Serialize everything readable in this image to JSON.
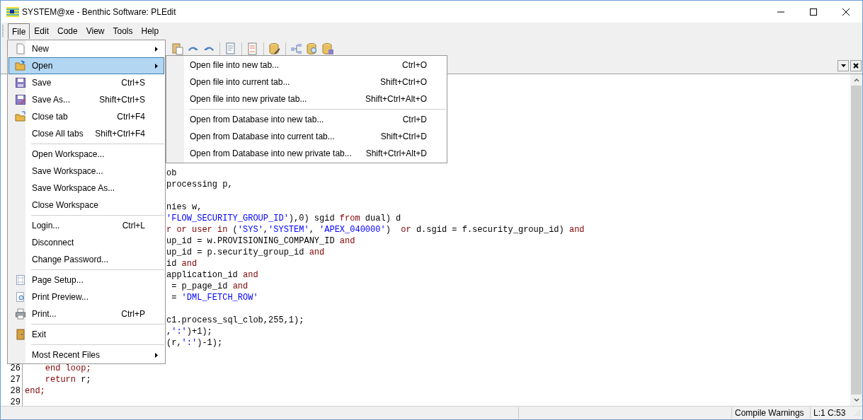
{
  "window": {
    "title": "SYSTEM@xe - Benthic Software: PLEdit"
  },
  "menubar": [
    {
      "label": "File",
      "selected": true
    },
    {
      "label": "Edit",
      "selected": false
    },
    {
      "label": "Code",
      "selected": false
    },
    {
      "label": "View",
      "selected": false
    },
    {
      "label": "Tools",
      "selected": false
    },
    {
      "label": "Help",
      "selected": false
    }
  ],
  "file_menu": [
    {
      "kind": "item",
      "label": "New",
      "submenu": true,
      "selected": false
    },
    {
      "kind": "item",
      "label": "Open",
      "submenu": true,
      "selected": true
    },
    {
      "kind": "item",
      "label": "Save",
      "shortcut": "Ctrl+S",
      "selected": false
    },
    {
      "kind": "item",
      "label": "Save As...",
      "shortcut": "Shift+Ctrl+S",
      "selected": false
    },
    {
      "kind": "item",
      "label": "Close tab",
      "shortcut": "Ctrl+F4",
      "selected": false
    },
    {
      "kind": "item",
      "label": "Close All tabs",
      "shortcut": "Shift+Ctrl+F4",
      "selected": false
    },
    {
      "kind": "separator"
    },
    {
      "kind": "item",
      "label": "Open Workspace...",
      "selected": false
    },
    {
      "kind": "item",
      "label": "Save Workspace...",
      "selected": false
    },
    {
      "kind": "item",
      "label": "Save Workspace As...",
      "selected": false
    },
    {
      "kind": "item",
      "label": "Close Workspace",
      "selected": false
    },
    {
      "kind": "separator"
    },
    {
      "kind": "item",
      "label": "Login...",
      "shortcut": "Ctrl+L",
      "selected": false
    },
    {
      "kind": "item",
      "label": "Disconnect",
      "selected": false
    },
    {
      "kind": "item",
      "label": "Change Password...",
      "selected": false
    },
    {
      "kind": "separator"
    },
    {
      "kind": "item",
      "label": "Page Setup...",
      "selected": false
    },
    {
      "kind": "item",
      "label": "Print Preview...",
      "selected": false
    },
    {
      "kind": "item",
      "label": "Print...",
      "shortcut": "Ctrl+P",
      "selected": false
    },
    {
      "kind": "separator"
    },
    {
      "kind": "item",
      "label": "Exit",
      "selected": false
    },
    {
      "kind": "separator"
    },
    {
      "kind": "item",
      "label": "Most Recent Files",
      "submenu": true,
      "selected": false
    }
  ],
  "open_submenu": [
    {
      "kind": "item",
      "label": "Open file into new tab...",
      "shortcut": "Ctrl+O"
    },
    {
      "kind": "item",
      "label": "Open file into current tab...",
      "shortcut": "Shift+Ctrl+O"
    },
    {
      "kind": "item",
      "label": "Open file into new private tab...",
      "shortcut": "Shift+Ctrl+Alt+O"
    },
    {
      "kind": "separator"
    },
    {
      "kind": "item",
      "label": "Open from Database into new tab...",
      "shortcut": "Ctrl+D"
    },
    {
      "kind": "item",
      "label": "Open from Database into current tab...",
      "shortcut": "Shift+Ctrl+D"
    },
    {
      "kind": "item",
      "label": "Open from Database into new private tab...",
      "shortcut": "Shift+Ctrl+Alt+D"
    }
  ],
  "editor": {
    "fragment_groups": [
      [
        [
          {
            "kind": "plain",
            "text": "ob"
          }
        ],
        [
          {
            "kind": "plain",
            "text": "processing p,"
          }
        ]
      ],
      [
        [
          {
            "kind": "plain",
            "text": "nies w,"
          }
        ],
        [
          {
            "kind": "string",
            "text": "'FLOW_SECURITY_GROUP_ID'"
          },
          {
            "kind": "plain",
            "text": "),0) sgid "
          },
          {
            "kind": "keyword",
            "text": "from"
          },
          {
            "kind": "plain",
            "text": " dual) d"
          }
        ],
        [
          {
            "kind": "keyword",
            "text": "r or user in"
          },
          {
            "kind": "plain",
            "text": " ("
          },
          {
            "kind": "string",
            "text": "'SYS'"
          },
          {
            "kind": "plain",
            "text": ","
          },
          {
            "kind": "string",
            "text": "'SYSTEM'"
          },
          {
            "kind": "plain",
            "text": ", "
          },
          {
            "kind": "string",
            "text": "'APEX_040000'"
          },
          {
            "kind": "plain",
            "text": ")  "
          },
          {
            "kind": "keyword",
            "text": "or"
          },
          {
            "kind": "plain",
            "text": " d.sgid = f.security_group_id) "
          },
          {
            "kind": "keyword",
            "text": "and"
          }
        ],
        [
          {
            "kind": "plain",
            "text": "up_id = w.PROVISIONING_COMPANY_ID "
          },
          {
            "kind": "keyword",
            "text": "and"
          }
        ],
        [
          {
            "kind": "plain",
            "text": "up_id = p.security_group_id "
          },
          {
            "kind": "keyword",
            "text": "and"
          }
        ],
        [
          {
            "kind": "plain",
            "text": "id "
          },
          {
            "kind": "keyword",
            "text": "and"
          }
        ],
        [
          {
            "kind": "plain",
            "text": "application_id "
          },
          {
            "kind": "keyword",
            "text": "and"
          }
        ],
        [
          {
            "kind": "plain",
            "text": " = p_page_id "
          },
          {
            "kind": "keyword",
            "text": "and"
          }
        ],
        [
          {
            "kind": "plain",
            "text": " = "
          },
          {
            "kind": "string",
            "text": "'DML_FETCH_ROW'"
          }
        ]
      ],
      [
        [
          {
            "kind": "plain",
            "text": "c1.process_sql_clob,255,1);"
          }
        ],
        [
          {
            "kind": "plain",
            "text": ","
          },
          {
            "kind": "string",
            "text": "':'"
          },
          {
            "kind": "plain",
            "text": ")+1);"
          }
        ],
        [
          {
            "kind": "plain",
            "text": "(r,"
          },
          {
            "kind": "string",
            "text": "':'"
          },
          {
            "kind": "plain",
            "text": ")-1);"
          }
        ]
      ]
    ],
    "lines": [
      {
        "number": "26",
        "tokens": [
          {
            "kind": "keyword",
            "text": "    end loop;"
          }
        ]
      },
      {
        "number": "27",
        "tokens": [
          {
            "kind": "keyword",
            "text": "    return"
          },
          {
            "kind": "plain",
            "text": " r;"
          }
        ]
      },
      {
        "number": "28",
        "tokens": [
          {
            "kind": "keyword",
            "text": "end;"
          }
        ]
      },
      {
        "number": "29"
      }
    ]
  },
  "status_bar": {
    "compile": "Compile Warnings",
    "position": "L:1 C:53"
  }
}
